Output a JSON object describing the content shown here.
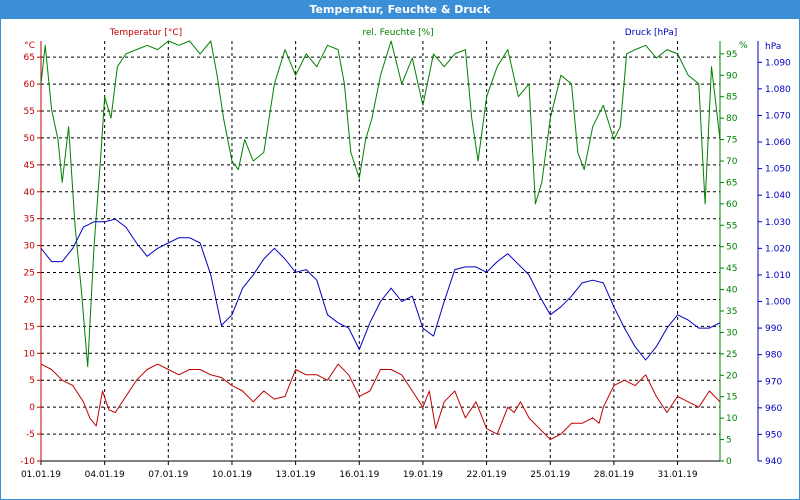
{
  "window": {
    "title": "Temperatur, Feuchte & Druck"
  },
  "colors": {
    "temperature": "#c00000",
    "humidity": "#008000",
    "pressure": "#0000c0",
    "grid": "#000000",
    "title_bar": "#3b8fd7"
  },
  "chart_data": {
    "type": "line",
    "x_tick_labels": [
      "01.01.19",
      "04.01.19",
      "07.01.19",
      "10.01.19",
      "13.01.19",
      "16.01.19",
      "19.01.19",
      "22.01.19",
      "25.01.19",
      "28.01.19",
      "31.01.19"
    ],
    "x_range_days": [
      0,
      32
    ],
    "grid": true,
    "axes": {
      "left": {
        "label": "Temperatur [°C]",
        "unit": "°C",
        "min": -10,
        "max": 68,
        "ticks": [
          -10,
          -5,
          0,
          5,
          10,
          15,
          20,
          25,
          30,
          35,
          40,
          45,
          50,
          55,
          60,
          65
        ]
      },
      "middle": {
        "label": "rel. Feuchte [%]",
        "unit": "%",
        "min": 0,
        "max": 98,
        "ticks": [
          0,
          5,
          10,
          15,
          20,
          25,
          30,
          35,
          40,
          45,
          50,
          55,
          60,
          65,
          70,
          75,
          80,
          85,
          90,
          95
        ]
      },
      "right": {
        "label": "Druck [hPa]",
        "unit": "hPa",
        "min": 940,
        "max": 1098,
        "ticks": [
          "940",
          "950",
          "960",
          "970",
          "980",
          "990",
          "1.000",
          "1.010",
          "1.020",
          "1.030",
          "1.040",
          "1.050",
          "1.060",
          "1.070",
          "1.080",
          "1.090"
        ]
      }
    },
    "series": [
      {
        "name": "Temperatur [°C]",
        "axis": "left",
        "color": "#c00000",
        "points": [
          [
            0,
            8
          ],
          [
            0.5,
            7
          ],
          [
            1,
            5
          ],
          [
            1.5,
            4
          ],
          [
            2,
            1
          ],
          [
            2.3,
            -2
          ],
          [
            2.6,
            -3.5
          ],
          [
            2.9,
            3
          ],
          [
            3.2,
            -0.5
          ],
          [
            3.5,
            -1
          ],
          [
            4,
            2
          ],
          [
            4.5,
            5
          ],
          [
            5,
            7
          ],
          [
            5.5,
            8
          ],
          [
            6,
            7
          ],
          [
            6.5,
            6
          ],
          [
            7,
            7
          ],
          [
            7.5,
            7
          ],
          [
            8,
            6
          ],
          [
            8.5,
            5.5
          ],
          [
            9,
            4
          ],
          [
            9.5,
            3
          ],
          [
            10,
            1
          ],
          [
            10.5,
            3
          ],
          [
            11,
            1.5
          ],
          [
            11.5,
            2
          ],
          [
            12,
            7
          ],
          [
            12.5,
            6
          ],
          [
            13,
            6
          ],
          [
            13.5,
            5
          ],
          [
            14,
            8
          ],
          [
            14.5,
            6
          ],
          [
            15,
            2
          ],
          [
            15.5,
            3
          ],
          [
            16,
            7
          ],
          [
            16.5,
            7
          ],
          [
            17,
            6
          ],
          [
            17.5,
            3
          ],
          [
            18,
            0
          ],
          [
            18.3,
            3
          ],
          [
            18.6,
            -4
          ],
          [
            19,
            1
          ],
          [
            19.5,
            3
          ],
          [
            20,
            -2
          ],
          [
            20.5,
            1
          ],
          [
            21,
            -4
          ],
          [
            21.5,
            -5
          ],
          [
            22,
            0
          ],
          [
            22.3,
            -1
          ],
          [
            22.6,
            1
          ],
          [
            23,
            -2
          ],
          [
            23.5,
            -4
          ],
          [
            24,
            -6
          ],
          [
            24.5,
            -5
          ],
          [
            25,
            -3
          ],
          [
            25.5,
            -3
          ],
          [
            26,
            -2
          ],
          [
            26.3,
            -3
          ],
          [
            26.5,
            0
          ],
          [
            27,
            4
          ],
          [
            27.5,
            5
          ],
          [
            28,
            4
          ],
          [
            28.5,
            6
          ],
          [
            29,
            2
          ],
          [
            29.5,
            -1
          ],
          [
            30,
            2
          ],
          [
            30.5,
            1
          ],
          [
            31,
            0
          ],
          [
            31.5,
            3
          ],
          [
            32,
            1
          ]
        ]
      },
      {
        "name": "rel. Feuchte [%]",
        "axis": "middle",
        "color": "#008000",
        "points": [
          [
            0,
            88
          ],
          [
            0.2,
            97
          ],
          [
            0.5,
            82
          ],
          [
            0.8,
            75
          ],
          [
            1,
            65
          ],
          [
            1.3,
            78
          ],
          [
            1.6,
            55
          ],
          [
            1.9,
            40
          ],
          [
            2.2,
            22
          ],
          [
            2.5,
            50
          ],
          [
            2.8,
            70
          ],
          [
            3,
            85
          ],
          [
            3.3,
            80
          ],
          [
            3.6,
            92
          ],
          [
            4,
            95
          ],
          [
            4.5,
            96
          ],
          [
            5,
            97
          ],
          [
            5.5,
            96
          ],
          [
            6,
            98
          ],
          [
            6.5,
            97
          ],
          [
            7,
            98
          ],
          [
            7.5,
            95
          ],
          [
            8,
            98
          ],
          [
            8.3,
            90
          ],
          [
            8.6,
            80
          ],
          [
            9,
            70
          ],
          [
            9.3,
            68
          ],
          [
            9.6,
            75
          ],
          [
            10,
            70
          ],
          [
            10.5,
            72
          ],
          [
            11,
            88
          ],
          [
            11.5,
            96
          ],
          [
            12,
            90
          ],
          [
            12.5,
            95
          ],
          [
            13,
            92
          ],
          [
            13.5,
            97
          ],
          [
            14,
            96
          ],
          [
            14.3,
            88
          ],
          [
            14.6,
            72
          ],
          [
            15,
            66
          ],
          [
            15.3,
            75
          ],
          [
            15.6,
            80
          ],
          [
            16,
            90
          ],
          [
            16.5,
            98
          ],
          [
            17,
            88
          ],
          [
            17.5,
            94
          ],
          [
            18,
            83
          ],
          [
            18.5,
            95
          ],
          [
            19,
            92
          ],
          [
            19.5,
            95
          ],
          [
            20,
            96
          ],
          [
            20.3,
            80
          ],
          [
            20.6,
            70
          ],
          [
            21,
            85
          ],
          [
            21.5,
            92
          ],
          [
            22,
            96
          ],
          [
            22.5,
            85
          ],
          [
            23,
            88
          ],
          [
            23.3,
            60
          ],
          [
            23.6,
            65
          ],
          [
            24,
            80
          ],
          [
            24.5,
            90
          ],
          [
            25,
            88
          ],
          [
            25.3,
            72
          ],
          [
            25.6,
            68
          ],
          [
            26,
            78
          ],
          [
            26.5,
            83
          ],
          [
            27,
            75
          ],
          [
            27.3,
            78
          ],
          [
            27.6,
            95
          ],
          [
            28,
            96
          ],
          [
            28.5,
            97
          ],
          [
            29,
            94
          ],
          [
            29.5,
            96
          ],
          [
            30,
            95
          ],
          [
            30.5,
            90
          ],
          [
            31,
            88
          ],
          [
            31.3,
            60
          ],
          [
            31.6,
            92
          ],
          [
            32,
            75
          ]
        ]
      },
      {
        "name": "Druck [hPa]",
        "axis": "right",
        "color": "#0000c0",
        "points": [
          [
            0,
            1020
          ],
          [
            0.5,
            1015
          ],
          [
            1,
            1015
          ],
          [
            1.5,
            1020
          ],
          [
            2,
            1028
          ],
          [
            2.5,
            1030
          ],
          [
            3,
            1030
          ],
          [
            3.5,
            1031
          ],
          [
            4,
            1028
          ],
          [
            4.5,
            1022
          ],
          [
            5,
            1017
          ],
          [
            5.5,
            1020
          ],
          [
            6,
            1022
          ],
          [
            6.5,
            1024
          ],
          [
            7,
            1024
          ],
          [
            7.5,
            1022
          ],
          [
            8,
            1010
          ],
          [
            8.5,
            991
          ],
          [
            9,
            995
          ],
          [
            9.5,
            1005
          ],
          [
            10,
            1010
          ],
          [
            10.5,
            1016
          ],
          [
            11,
            1020
          ],
          [
            11.5,
            1016
          ],
          [
            12,
            1011
          ],
          [
            12.5,
            1012
          ],
          [
            13,
            1008
          ],
          [
            13.5,
            995
          ],
          [
            14,
            992
          ],
          [
            14.5,
            990
          ],
          [
            15,
            982
          ],
          [
            15.5,
            992
          ],
          [
            16,
            1000
          ],
          [
            16.5,
            1005
          ],
          [
            17,
            1000
          ],
          [
            17.5,
            1002
          ],
          [
            18,
            990
          ],
          [
            18.5,
            987
          ],
          [
            19,
            1000
          ],
          [
            19.5,
            1012
          ],
          [
            20,
            1013
          ],
          [
            20.5,
            1013
          ],
          [
            21,
            1011
          ],
          [
            21.5,
            1015
          ],
          [
            22,
            1018
          ],
          [
            22.5,
            1014
          ],
          [
            23,
            1010
          ],
          [
            23.5,
            1002
          ],
          [
            24,
            995
          ],
          [
            24.5,
            998
          ],
          [
            25,
            1002
          ],
          [
            25.5,
            1007
          ],
          [
            26,
            1008
          ],
          [
            26.5,
            1007
          ],
          [
            27,
            998
          ],
          [
            27.5,
            990
          ],
          [
            28,
            983
          ],
          [
            28.5,
            978
          ],
          [
            29,
            983
          ],
          [
            29.5,
            990
          ],
          [
            30,
            995
          ],
          [
            30.5,
            993
          ],
          [
            31,
            990
          ],
          [
            31.5,
            990
          ],
          [
            32,
            992
          ]
        ]
      }
    ]
  }
}
